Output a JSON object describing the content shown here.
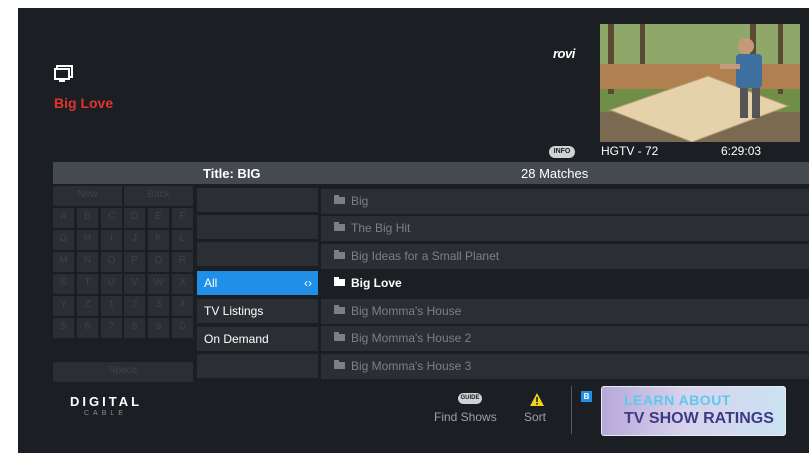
{
  "program_title": "Big Love",
  "brand": "rovi",
  "preview": {
    "info_label": "INFO",
    "channel": "HGTV - 72",
    "time": "6:29:03"
  },
  "search": {
    "title_label": "Title: BIG",
    "matches_label": "28 Matches"
  },
  "keyboard": {
    "new_label": "New",
    "back_label": "Back",
    "rows": [
      [
        "A",
        "B",
        "C",
        "D",
        "E",
        "F"
      ],
      [
        "G",
        "H",
        "I",
        "J",
        "K",
        "L"
      ],
      [
        "M",
        "N",
        "O",
        "P",
        "Q",
        "R"
      ],
      [
        "S",
        "T",
        "U",
        "V",
        "W",
        "X"
      ],
      [
        "Y",
        "Z",
        "1",
        "2",
        "3",
        "4"
      ],
      [
        "5",
        "6",
        "7",
        "8",
        "9",
        "0"
      ]
    ],
    "space_label": "Space"
  },
  "filters": [
    {
      "label": "",
      "selected": false
    },
    {
      "label": "",
      "selected": false
    },
    {
      "label": "",
      "selected": false
    },
    {
      "label": "All",
      "selected": true,
      "arrows": "‹›"
    },
    {
      "label": "TV Listings",
      "selected": false
    },
    {
      "label": "On Demand",
      "selected": false
    },
    {
      "label": "",
      "selected": false
    }
  ],
  "results": [
    {
      "title": "Big",
      "selected": false
    },
    {
      "title": "The Big Hit",
      "selected": false
    },
    {
      "title": "Big Ideas for a Small Planet",
      "selected": false
    },
    {
      "title": "Big Love",
      "selected": true
    },
    {
      "title": "Big Momma's House",
      "selected": false
    },
    {
      "title": "Big Momma's House 2",
      "selected": false
    },
    {
      "title": "Big Momma's House 3",
      "selected": false
    }
  ],
  "footer": {
    "logo_main": "DIGITAL",
    "logo_sub": "CABLE",
    "guide_label": "GUIDE",
    "find_shows_label": "Find Shows",
    "sort_label": "Sort",
    "b_key_label": "B",
    "banner_line1": "LEARN ABOUT",
    "banner_line2": "TV SHOW RATINGS"
  },
  "colors": {
    "background": "#1b1e22",
    "accent_red": "#e3342c",
    "selection_blue": "#1f8fe8",
    "header_gray": "#454a50"
  },
  "icons": [
    "tv-icon",
    "folder-icon",
    "warning-icon",
    "info-button-icon",
    "guide-button-icon"
  ]
}
